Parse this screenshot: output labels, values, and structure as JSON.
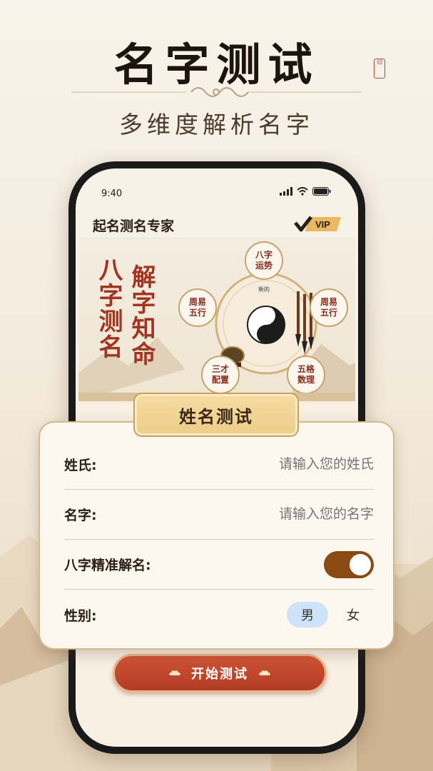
{
  "promo": {
    "title": "名字测试",
    "subtitle": "多维度解析名字",
    "seal_text": "篆印"
  },
  "status_bar": {
    "time": "9:40"
  },
  "app": {
    "title": "起名测名专家",
    "vip_label": "VIP"
  },
  "banner": {
    "slogan_col1": "八字测名",
    "slogan_col2": "解字知命",
    "wheel_items": [
      "八字\n运势",
      "周易\n五行",
      "周易\n五行",
      "三才\n配置",
      "五格\n数理"
    ],
    "center_caption": "新的"
  },
  "form": {
    "tab_title": "姓名测试",
    "surname_label": "姓氏:",
    "surname_placeholder": "请输入您的姓氏",
    "name_label": "名字:",
    "name_placeholder": "请输入您的名字",
    "bazi_label": "八字精准解名:",
    "bazi_enabled": true,
    "gender_label": "性别:",
    "gender_options": [
      "男",
      "女"
    ],
    "gender_selected": "男"
  },
  "start_button": {
    "label": "开始测试"
  },
  "colors": {
    "accent_red": "#b03b23",
    "toggle_brown": "#8b4a12",
    "gold": "#eccd89",
    "selected_blue": "#cfe3f8"
  }
}
